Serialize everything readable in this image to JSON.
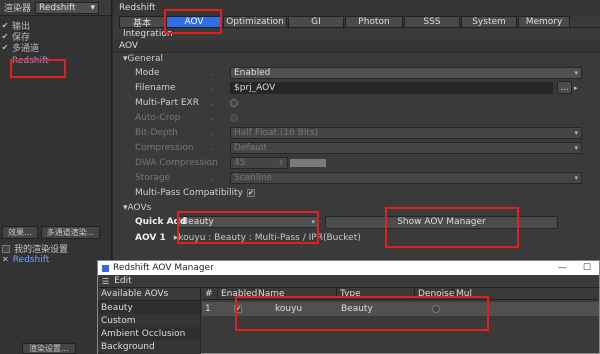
{
  "left": {
    "renderer_label": "渲染器",
    "renderer_value": "Redshift",
    "tree": [
      {
        "label": "输出",
        "checked": true
      },
      {
        "label": "保存",
        "checked": true
      },
      {
        "label": "多通道",
        "checked": true
      },
      {
        "label": "Redshift",
        "checked": false
      }
    ],
    "btn_effects": "效果...",
    "btn_multipass": "多通道渲染...",
    "my_settings": "我的渲染设置",
    "my_redshift": "Redshift",
    "render_settings_btn": "渲染设置..."
  },
  "right": {
    "title": "Redshift",
    "tabs": [
      "基本",
      "AOV",
      "Optimization",
      "GI",
      "Photon",
      "SSS",
      "System",
      "Memory"
    ],
    "active_tab": "AOV",
    "integration": "Integration",
    "section": "AOV",
    "general": "▾General",
    "props": {
      "mode_label": "Mode",
      "mode_value": "Enabled",
      "filename_label": "Filename",
      "filename_value": "$prj_AOV",
      "filename_btn": "...",
      "multipart_label": "Multi-Part EXR",
      "autocrop_label": "Auto-Crop",
      "bitdepth_label": "Bit-Depth",
      "bitdepth_value": "Half Float (16 Bits)",
      "compression_label": "Compression",
      "compression_value": "Default",
      "dwa_label": "DWA Compression",
      "dwa_value": "45",
      "storage_label": "Storage",
      "storage_value": "Scanline",
      "mpc_label": "Multi-Pass Compatibility"
    },
    "aovs_header": "▾AOVs",
    "quickadd_label": "Quick Add",
    "quickadd_value": "Beauty",
    "show_manager": "Show AOV Manager",
    "aov1_label": "AOV 1",
    "aov1_value": "▸kouyu : Beauty : Multi-Pass / IPR(Bucket)"
  },
  "manager": {
    "title": "Redshift AOV Manager",
    "menu_edit": "Edit",
    "available_header": "Available AOVs",
    "available": [
      "Beauty",
      "Custom",
      "Ambient Occlusion",
      "Background"
    ],
    "columns": [
      "#",
      "Enabled",
      "Name",
      "Type",
      "Denoise",
      "Mul"
    ],
    "row": {
      "num": "1",
      "name": "kouyu",
      "type": "Beauty"
    }
  },
  "colors": {
    "highlight_box": "#e32020",
    "active_tab": "#2e6fe8",
    "link": "#6fa4ff"
  }
}
